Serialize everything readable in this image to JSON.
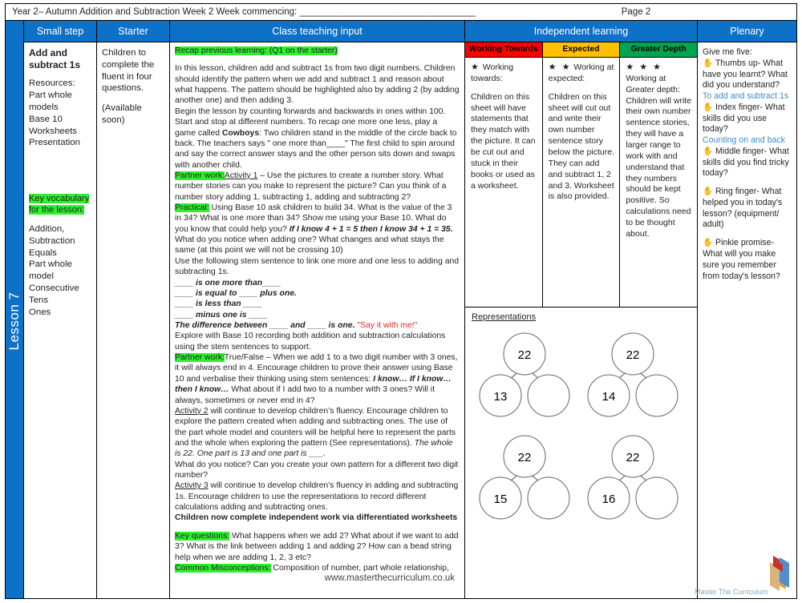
{
  "header": {
    "left_text": "Year 2– Autumn Addition and Subtraction Week 2   Week commencing: _______________________________________",
    "page_label": "Page 2"
  },
  "spine": {
    "lesson_label": "Lesson 7"
  },
  "columns": {
    "small_step": "Small step",
    "starter": "Starter",
    "class_teaching_input": "Class teaching input",
    "independent_learning": "Independent learning",
    "plenary": "Plenary"
  },
  "small_step": {
    "title": "Add and subtract 1s",
    "resources_heading": "Resources:",
    "resources": "Part whole models\nBase 10\nWorksheets\nPresentation",
    "vocab_heading": "Key vocabulary for the lesson:",
    "vocab": "Addition,\nSubtraction\nEquals\nPart whole model\nConsecutive\nTens\nOnes"
  },
  "starter": {
    "line1": "Children to complete the fluent in four questions.",
    "line2": "(Available soon)"
  },
  "class_teaching": {
    "recap_label": "Recap previous learning: (Q1 on the starter)",
    "para1": "In this lesson, children add and subtract 1s from two digit numbers. Children should identify the pattern when we add and subtract 1 and reason about what happens. The pattern should be highlighted also by adding 2 (by adding another one) and then adding 3.",
    "para2_a": "Begin the lesson by counting forwards and backwards in ones within 100. Start and stop at different numbers. To recap one more one less,  play a game called ",
    "para2_bold": "Cowboys",
    "para2_b": ":  Two children stand in the middle of the circle back to back. The teachers says \" one more than____\"  The first child to spin around and say the correct answer stays and the other person sits down and swaps with another child.",
    "partner1_label": "Partner work:",
    "partner1_activity": "Activity 1",
    "partner1_text": " – Use the pictures to create a number story. What number stories can you make to represent the picture?    Can you think of a number story adding 1, subtracting 1, adding and subtracting 2?",
    "practical_label": "Practical:",
    "practical_a": "  Using Base 10 ask children to build 34.  What is the value of the 3 in 34?    What is one more than 34?  Show me using your Base 10.   What do you know that could help you?  ",
    "practical_bold": "If I know 4 + 1 = 5 then I know 34 + 1 = 35.",
    "practical_b": " What do you notice when adding one?  What changes and what stays the same (at this point we will not be crossing 10)",
    "stem_intro": "Use the following stem sentence to link one more and one less to adding and subtracting 1s.",
    "stems": [
      "____ is one more than____",
      "____ is equal to ____ plus one.",
      "____ is less than ____",
      "____  minus one is ____"
    ],
    "stem_last": "The difference between ____ and ____ is one.",
    "say_it": " \"Say it with me!\"",
    "explore": "Explore with Base 10 recording both addition and subtraction calculations using the stem sentences to support.",
    "partner2_label": "Partner work:",
    "partner2_a": "True/False – When we add 1 to a two digit number with 3 ones, it will always end in 4.  Encourage children to prove their answer using Base 10 and verbalise their thinking using stem sentences: ",
    "partner2_bold": "I know… If I know… then I know…",
    "partner2_b": "   What about if I add two to a number with 3 ones?  Will it always, sometimes or never end in 4?",
    "activity2_label": "Activity 2",
    "activity2_a": " will continue to develop children’s fluency.  Encourage children to explore the pattern created when adding and subtracting ones. The use of the part whole model and counters will be helpful here to represent the parts and the whole when exploring the pattern (See representations).  ",
    "activity2_italic": "The whole is 22. One part is 13 and one part is ___.",
    "activity2_b": "What do you notice? Can you create your own pattern for a different two digit number?",
    "activity3_label": "Activity 3",
    "activity3_text": " will continue to develop children’s fluency in adding and subtracting 1s.  Encourage children to use the representations to record different calculations adding and subtracting ones.",
    "independent_bold": "Children now complete independent work via differentiated  worksheets",
    "key_q_label": "Key questions:",
    "key_q_text": " What happens when we add 2? What about if we want to add 3?  What is the link between adding 1 and adding 2?  How can a bead string help when we are adding 1, 2, 3 etc?",
    "misconception_label": "Common Misconceptions:",
    "misconception_text": " Composition of number, part whole relationship,",
    "watermark": "www.masterthecurriculum.co.uk"
  },
  "independent": {
    "bands": [
      {
        "header": "Working Towards",
        "color": "#FF0000",
        "stars": "★",
        "lead": "Working towards:",
        "body": "Children on this sheet will have statements that they match with the picture. It can be cut out and\nstuck in their books or used as a worksheet."
      },
      {
        "header": "Expected",
        "color": "#FFC000",
        "stars": "★ ★",
        "lead": "Working at expected:",
        "body": "Children on this sheet will cut out\nand write their own number sentence story below the picture. They can add and subtract 1, 2 and 3. Worksheet is also provided."
      },
      {
        "header": "Greater Depth",
        "color": "#00A550",
        "stars": "★ ★ ★",
        "lead": "Working at Greater depth:",
        "body": "Children will write their own number sentence stories, they will have a larger range to work with and understand that they numbers should be kept positive. So calculations need to be thought about."
      }
    ],
    "representations_title": "Representations",
    "part_whole_models": [
      {
        "whole": "22",
        "part_a": "13",
        "part_b": ""
      },
      {
        "whole": "22",
        "part_a": "14",
        "part_b": ""
      },
      {
        "whole": "22",
        "part_a": "15",
        "part_b": ""
      },
      {
        "whole": "22",
        "part_a": "16",
        "part_b": ""
      }
    ]
  },
  "plenary": {
    "intro": "Give me five:",
    "items": [
      {
        "icon": "✋",
        "text": " Thumbs up- What have you learnt? What did you understand?",
        "answer": "To add and subtract 1s"
      },
      {
        "icon": "✋",
        "text": " Index finger- What skills did you use today?",
        "answer": "Counting on and back"
      },
      {
        "icon": "✋",
        "text": " Middle finger- What skills did you find tricky today?",
        "answer": ""
      },
      {
        "icon": "✋",
        "text": " Ring finger- What helped you in today's lesson? (equipment/ adult)",
        "answer": ""
      },
      {
        "icon": "✋",
        "text": " Pinkie promise- What will you make sure you remember from today's lesson?",
        "answer": ""
      }
    ]
  },
  "logo": {
    "text": "Master The Curriculum"
  }
}
